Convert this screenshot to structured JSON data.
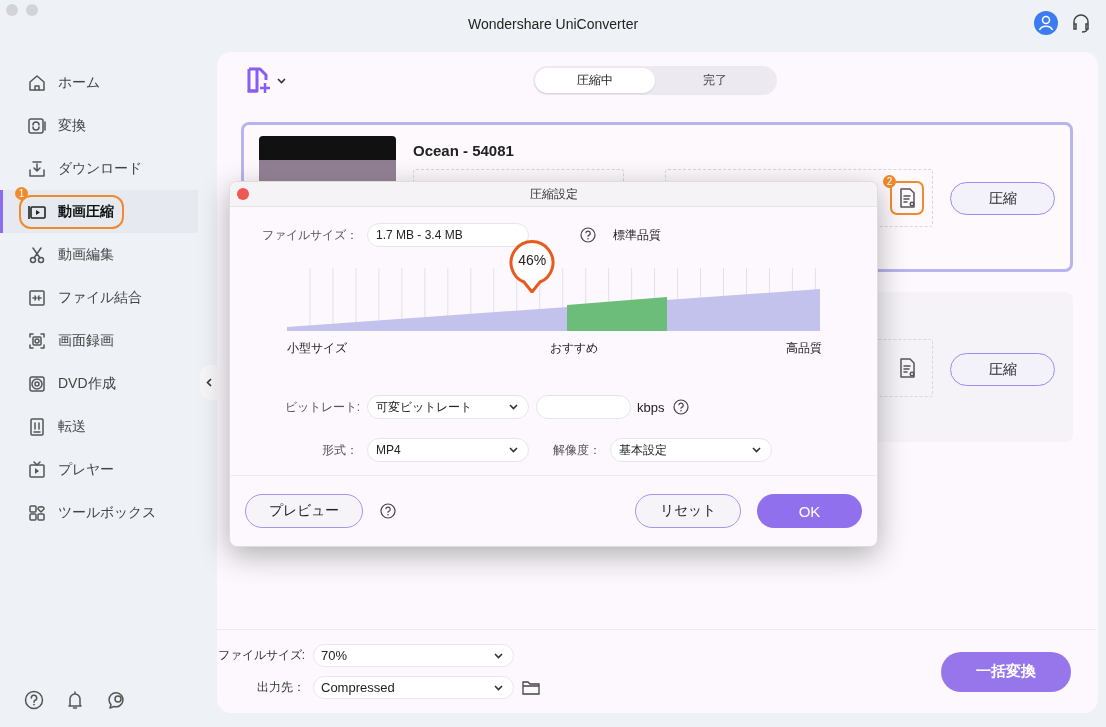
{
  "window": {
    "title": "Wondershare UniConverter"
  },
  "sidebar": {
    "items": [
      {
        "label": "ホーム",
        "selected": false
      },
      {
        "label": "変換",
        "selected": false
      },
      {
        "label": "ダウンロード",
        "selected": false
      },
      {
        "label": "動画圧縮",
        "selected": true,
        "badge": "1"
      },
      {
        "label": "動画編集",
        "selected": false
      },
      {
        "label": "ファイル結合",
        "selected": false
      },
      {
        "label": "画面録画",
        "selected": false
      },
      {
        "label": "DVD作成",
        "selected": false
      },
      {
        "label": "転送",
        "selected": false
      },
      {
        "label": "プレヤー",
        "selected": false
      },
      {
        "label": "ツールボックス",
        "selected": false
      }
    ]
  },
  "tabs": [
    {
      "label": "圧縮中",
      "selected": true
    },
    {
      "label": "完了",
      "selected": false
    }
  ],
  "files": [
    {
      "title": "Ocean - 54081",
      "selected": true,
      "settings_badge": "2",
      "button": "圧縮"
    },
    {
      "selected": false,
      "button": "圧縮"
    }
  ],
  "footer": {
    "file_size": {
      "label": "ファイルサイズ:",
      "value": "70%"
    },
    "output": {
      "label": "出力先：",
      "value": "Compressed"
    },
    "convert_all": "一括変換"
  },
  "dialog": {
    "title": "圧縮設定",
    "file_size": {
      "label": "ファイルサイズ：",
      "value": "1.7 MB - 3.4 MB"
    },
    "quality": "標準品質",
    "slider": {
      "level": 0.46,
      "reading": "46%",
      "min_label": "小型サイズ",
      "mid_label": "おすすめ",
      "max_label": "高品質"
    },
    "bitrate": {
      "label": "ビットレート:",
      "value": "可変ビットレート",
      "unit": "kbps"
    },
    "format": {
      "label": "形式：",
      "value": "MP4"
    },
    "resolution": {
      "label": "解像度：",
      "value": "基本設定"
    },
    "buttons": {
      "preview": "プレビュー",
      "reset": "リセット",
      "ok": "OK"
    }
  }
}
